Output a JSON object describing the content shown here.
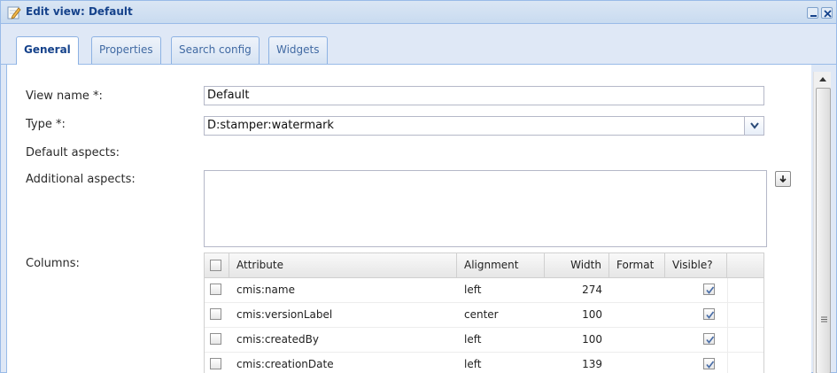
{
  "window": {
    "title": "Edit view: Default",
    "icons": {
      "title": "edit-pencil-icon",
      "minimize": "minimize-icon",
      "close": "close-icon"
    }
  },
  "tabs": [
    {
      "label": "General",
      "active": true
    },
    {
      "label": "Properties",
      "active": false
    },
    {
      "label": "Search config",
      "active": false
    },
    {
      "label": "Widgets",
      "active": false
    }
  ],
  "form": {
    "view_name_label": "View name *:",
    "view_name_value": "Default",
    "type_label": "Type *:",
    "type_value": "D:stamper:watermark",
    "default_aspects_label": "Default aspects:",
    "additional_aspects_label": "Additional aspects:",
    "additional_aspects_value": "",
    "columns_label": "Columns:"
  },
  "columns_grid": {
    "headers": {
      "attribute": "Attribute",
      "alignment": "Alignment",
      "width": "Width",
      "format": "Format",
      "visible": "Visible?"
    },
    "rows": [
      {
        "attribute": "cmis:name",
        "alignment": "left",
        "width": "274",
        "format": "",
        "visible": true
      },
      {
        "attribute": "cmis:versionLabel",
        "alignment": "center",
        "width": "100",
        "format": "",
        "visible": true
      },
      {
        "attribute": "cmis:createdBy",
        "alignment": "left",
        "width": "100",
        "format": "",
        "visible": true
      },
      {
        "attribute": "cmis:creationDate",
        "alignment": "left",
        "width": "139",
        "format": "",
        "visible": true
      }
    ]
  },
  "colors": {
    "title_text": "#15428b",
    "window_border": "#99bbe8",
    "tab_text": "#416aa3"
  }
}
